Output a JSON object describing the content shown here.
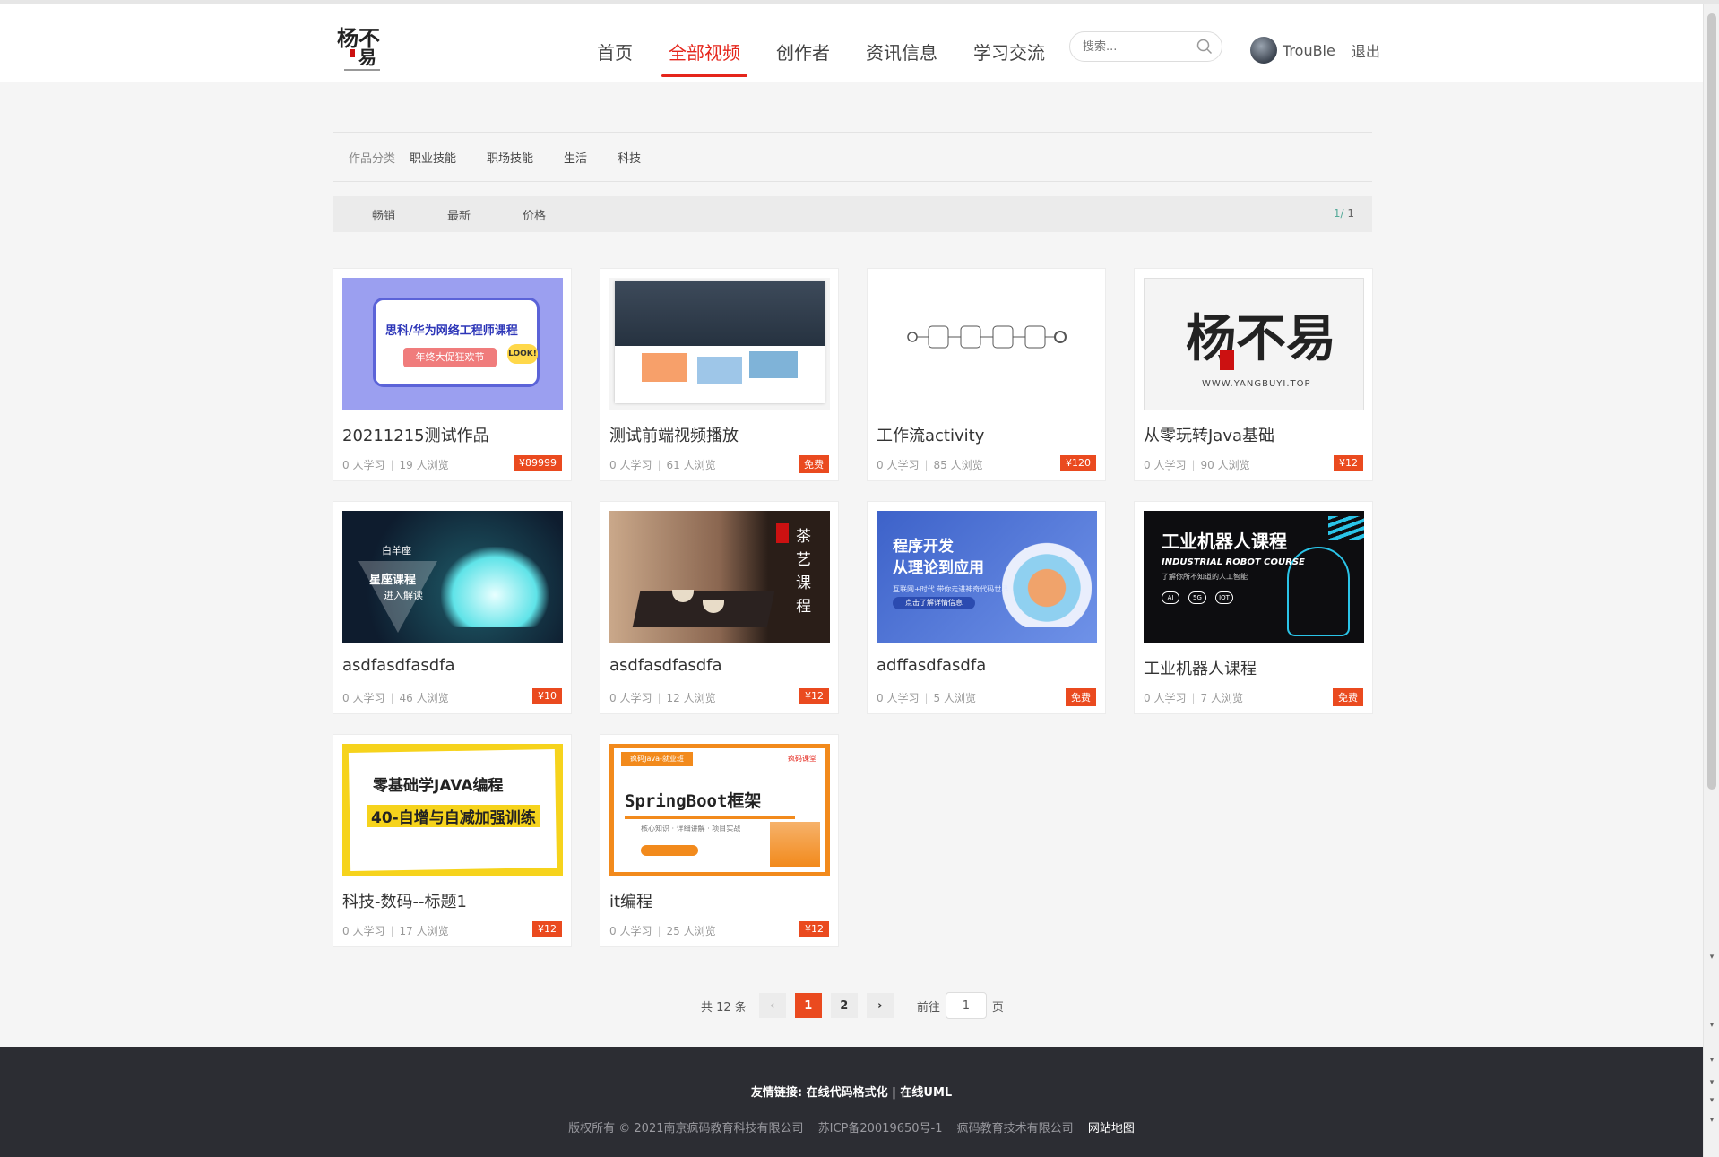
{
  "header": {
    "nav": [
      "首页",
      "全部视频",
      "创作者",
      "资讯信息",
      "学习交流"
    ],
    "active_nav": "全部视频",
    "search_placeholder": "搜索...",
    "username": "TrouBle",
    "logout": "退出"
  },
  "filters": {
    "category_label": "作品分类",
    "categories": [
      "职业技能",
      "职场技能",
      "生活",
      "科技"
    ],
    "sort": [
      "畅销",
      "最新",
      "价格"
    ],
    "page_current": "1",
    "page_sep": "/",
    "page_total": "1"
  },
  "courses": [
    {
      "title": "20211215测试作品",
      "learners": "0 人学习",
      "views": "19 人浏览",
      "price": "¥89999",
      "thumb_text": {
        "a": "思科/华为网络工程师课程",
        "b": "年终大促狂欢节",
        "c": "LOOK!"
      }
    },
    {
      "title": "测试前端视频播放",
      "learners": "0 人学习",
      "views": "61 人浏览",
      "price": "免费"
    },
    {
      "title": "工作流activity",
      "learners": "0 人学习",
      "views": "85 人浏览",
      "price": "¥120"
    },
    {
      "title": "从零玩转Java基础",
      "learners": "0 人学习",
      "views": "90 人浏览",
      "price": "¥12",
      "thumb_text": {
        "a": "杨不易",
        "b": "WWW.YANGBUYI.TOP"
      }
    },
    {
      "title": "asdfasdfasdfa",
      "learners": "0 人学习",
      "views": "46 人浏览",
      "price": "¥10",
      "thumb_text": {
        "a": "白羊座",
        "b": "星座课程",
        "c": "进入解读"
      }
    },
    {
      "title": "asdfasdfasdfa",
      "learners": "0 人学习",
      "views": "12 人浏览",
      "price": "¥12",
      "thumb_text": {
        "a": "茶艺课程"
      }
    },
    {
      "title": "adffasdfasdfa",
      "learners": "0 人学习",
      "views": "5 人浏览",
      "price": "免费",
      "thumb_text": {
        "a": "程序开发",
        "b": "从理论到应用",
        "c": "互联网+时代 带你走进神奇代码世界",
        "d": "点击了解详情信息"
      }
    },
    {
      "title": "工业机器人课程",
      "learners": "0 人学习",
      "views": "7 人浏览",
      "price": "免费",
      "thumb_text": {
        "a": "工业机器人课程",
        "b": "INDUSTRIAL ROBOT COURSE",
        "c": "了解你所不知道的人工智能",
        "d": "AI",
        "e": "5G",
        "f": "IOT"
      }
    },
    {
      "title": "科技-数码--标题1",
      "learners": "0 人学习",
      "views": "17 人浏览",
      "price": "¥12",
      "thumb_text": {
        "a": "零基础学JAVA编程",
        "b": "40-自增与自减加强训练"
      }
    },
    {
      "title": "it编程",
      "learners": "0 人学习",
      "views": "25 人浏览",
      "price": "¥12",
      "thumb_text": {
        "a": "疯码Java-就业班",
        "b": "SpringBoot框架",
        "c": "核心知识 · 详细讲解 · 项目实战",
        "d": "疯码课堂"
      }
    }
  ],
  "pagination": {
    "total": "共 12 条",
    "prev": "‹",
    "pages": [
      "1",
      "2"
    ],
    "active": "1",
    "next": "›",
    "goto_label": "前往",
    "goto_value": "1",
    "goto_suffix": "页"
  },
  "footer": {
    "links_label": "友情链接:",
    "link1": "在线代码格式化",
    "divider": "|",
    "link2": "在线UML",
    "copyright": "版权所有 © 2021南京疯码教育科技有限公司",
    "icp": "苏ICP备20019650号-1",
    "company": "疯码教育技术有限公司",
    "sitemap": "网站地图"
  },
  "colors": {
    "accent": "#e5251b",
    "price_bg": "#ea4a1f",
    "footer_bg": "#2c2d33"
  }
}
